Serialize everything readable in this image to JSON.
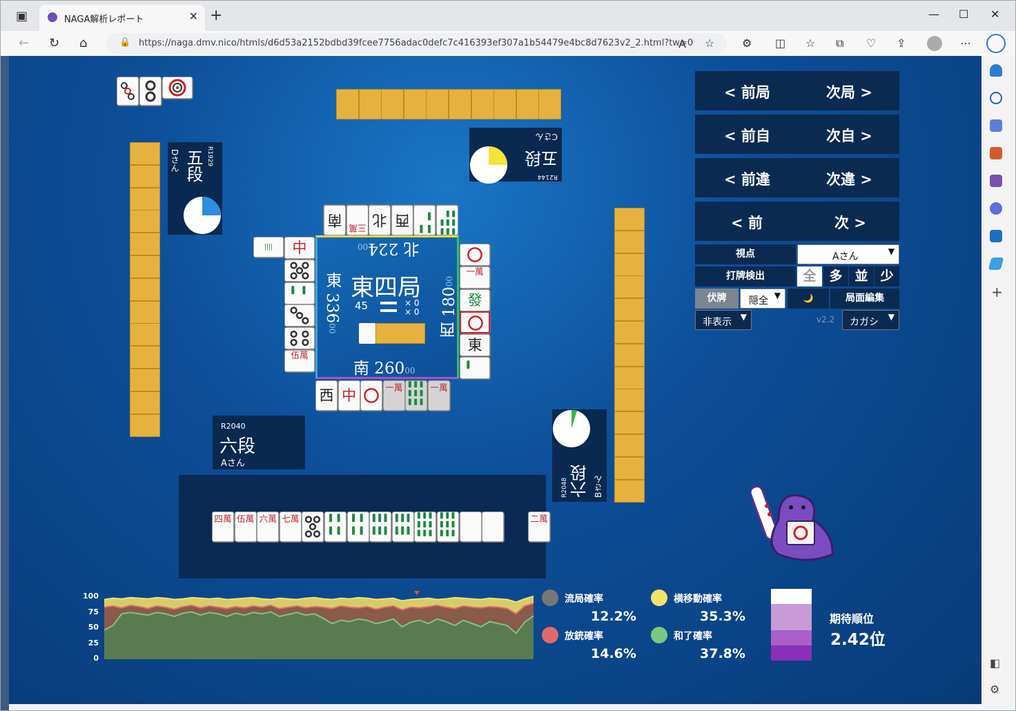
{
  "browser": {
    "tab_title": "NAGA解析レポート",
    "url": "https://naga.dmv.nico/htmls/d6d53a2152bdbd39fcee7756adac0defc7c416393ef307a1b54479e4bc8d7623v2_2.html?tw=0"
  },
  "players": {
    "top": {
      "rating": "R2144",
      "rank": "五段",
      "name": "Cさん"
    },
    "left": {
      "rating": "R1929",
      "rank": "五段",
      "name": "Dさん"
    },
    "right": {
      "rating": "R2048",
      "rank": "六段",
      "name": "Bさん"
    },
    "bottom": {
      "rating": "R2040",
      "rank": "六段",
      "name": "Aさん"
    }
  },
  "center": {
    "round": "東四局",
    "remaining": "45",
    "honba": "× 0",
    "riichi": "× 0",
    "north": "北 224",
    "north_sub": "00",
    "east": "東 336",
    "east_sub": "00",
    "west": "西 180",
    "west_sub": "00",
    "south": "南 260",
    "south_sub": "00"
  },
  "controls": {
    "prev_round": "< 前局",
    "next_round": "次局 >",
    "prev_self": "< 前自",
    "next_self": "次自 >",
    "prev_diff": "< 前違",
    "next_diff": "次違 >",
    "prev": "< 前",
    "next": "次 >",
    "view_label": "視点",
    "view_value": "Aさん",
    "detect_label": "打牌検出",
    "detect_options": [
      "全",
      "多",
      "並",
      "少"
    ],
    "hide_label": "伏牌",
    "hide_value": "隠全",
    "moon": "🌙",
    "edit_label": "局面編集",
    "display_value": "非表示",
    "version": "v2.2",
    "kana_value": "カガシ"
  },
  "hand": [
    "四萬",
    "伍萬",
    "六萬",
    "七萬",
    "5筒",
    "4索",
    "4索",
    "6索",
    "6索",
    "9索",
    "9索",
    "",
    "",
    "二萬"
  ],
  "discards": {
    "bottom": [
      "西",
      "中",
      "1筒",
      "一萬",
      "9索",
      "一萬"
    ],
    "top": [
      "南",
      "三萬",
      "北",
      "西",
      "3索",
      "8索"
    ],
    "left": [
      "中",
      "5筒",
      "2索",
      "3筒",
      "4筒",
      "伍萬"
    ],
    "right": [
      "1筒",
      "一萬",
      "發",
      "1筒",
      "東",
      "1索"
    ]
  },
  "dora": [
    "3筒",
    "2筒",
    "1筒"
  ],
  "stats": {
    "ryukyoku_label": "流局確率",
    "ryukyoku": "12.2%",
    "yoko_label": "横移動確率",
    "yoko": "35.3%",
    "houju_label": "放銃確率",
    "houju": "14.6%",
    "agari_label": "和了確率",
    "agari": "37.8%",
    "rank_label": "期待順位",
    "rank": "2.42位",
    "colors": {
      "ryukyoku": "#777777",
      "houju": "#e06a6a",
      "yoko": "#f3e36a",
      "agari": "#7ec77e"
    }
  },
  "chart_data": {
    "type": "area",
    "ylim": [
      0,
      100
    ],
    "yticks": [
      "100",
      "75",
      "50",
      "25",
      "0"
    ],
    "series": [
      {
        "values": [
          92,
          94,
          93,
          95,
          94,
          93,
          95,
          94,
          92,
          93,
          95,
          94,
          93,
          94,
          92,
          93,
          94,
          95,
          93,
          92,
          94,
          93,
          92,
          94,
          95,
          93,
          92,
          94,
          93,
          95,
          94,
          92,
          93,
          94,
          90,
          92,
          93,
          94,
          92,
          93,
          95,
          94,
          93,
          92,
          94,
          93,
          92,
          88,
          93,
          97
        ]
      },
      {
        "values": [
          80,
          82,
          79,
          83,
          81,
          78,
          82,
          80,
          77,
          81,
          83,
          79,
          82,
          80,
          78,
          81,
          79,
          82,
          80,
          83,
          78,
          80,
          82,
          79,
          81,
          80,
          78,
          82,
          80,
          79,
          81,
          77,
          80,
          82,
          76,
          80,
          79,
          81,
          83,
          80,
          78,
          82,
          80,
          79,
          81,
          80,
          78,
          70,
          82,
          86
        ]
      },
      {
        "values": [
          45,
          52,
          70,
          72,
          70,
          68,
          72,
          70,
          66,
          71,
          73,
          68,
          72,
          70,
          66,
          71,
          68,
          72,
          70,
          73,
          66,
          69,
          72,
          68,
          70,
          63,
          55,
          60,
          58,
          62,
          60,
          55,
          58,
          62,
          50,
          57,
          60,
          55,
          62,
          58,
          52,
          60,
          55,
          50,
          58,
          55,
          52,
          40,
          57,
          67
        ]
      }
    ]
  }
}
